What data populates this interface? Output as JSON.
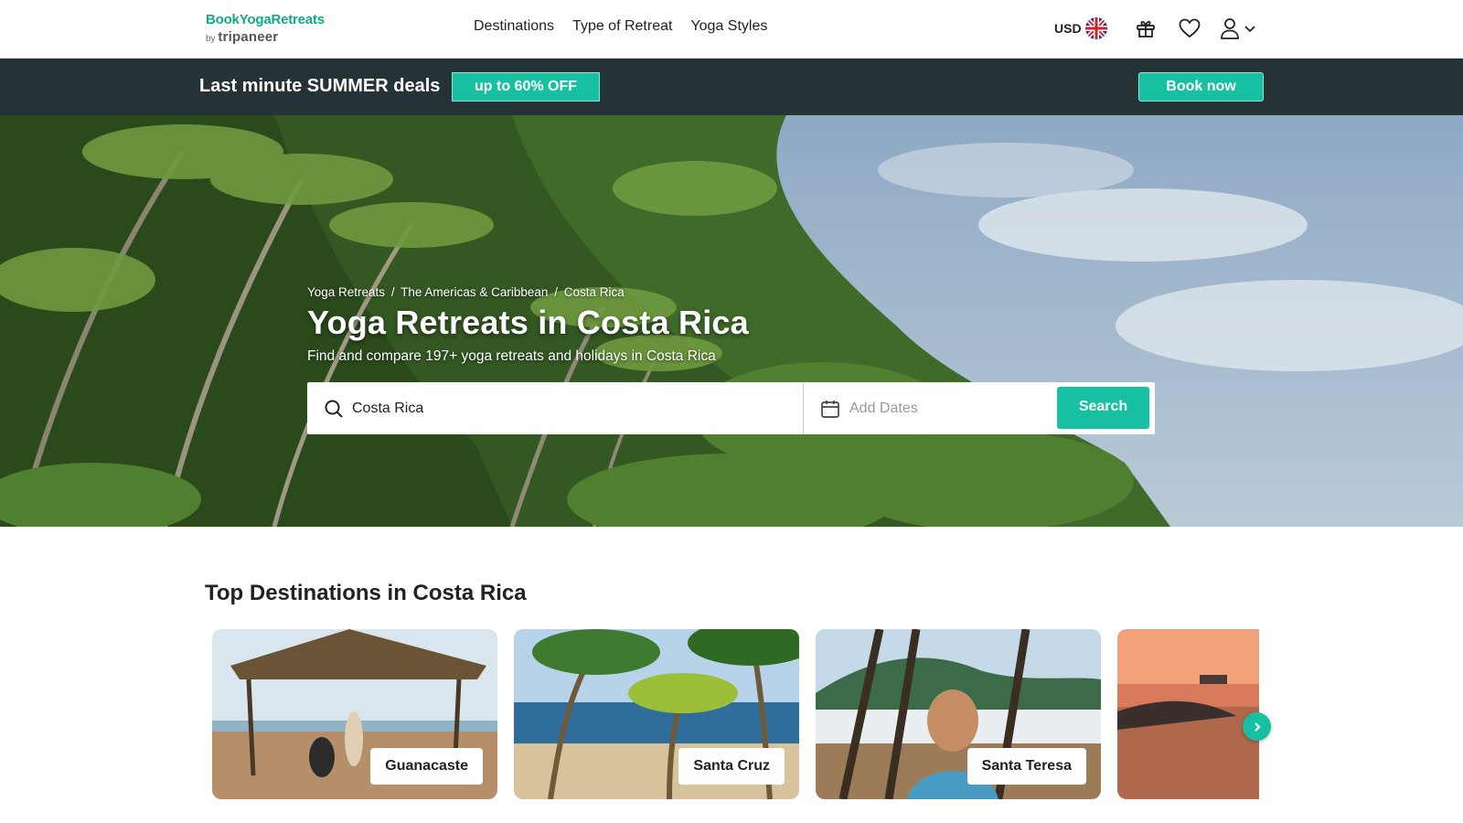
{
  "header": {
    "logo": {
      "name": "BookYogaRetreats",
      "by": "by",
      "brand": "tripaneer"
    },
    "nav": [
      {
        "label": "Destinations"
      },
      {
        "label": "Type of Retreat"
      },
      {
        "label": "Yoga Styles"
      }
    ],
    "currency": "USD",
    "icons": {
      "flag": "uk-flag-icon",
      "gift": "gift-icon",
      "wishlist": "heart-icon",
      "account": "user-icon",
      "dropdown": "chevron-down-icon"
    }
  },
  "promo": {
    "title": "Last minute SUMMER deals",
    "badge": "up to 60% OFF",
    "cta": "Book now"
  },
  "hero": {
    "breadcrumb": [
      "Yoga Retreats",
      "The Americas & Caribbean",
      "Costa Rica"
    ],
    "breadcrumb_sep": "/",
    "title": "Yoga Retreats in Costa Rica",
    "subtitle": "Find and compare 197+ yoga retreats and holidays in Costa Rica",
    "search": {
      "value": "Costa Rica",
      "date_placeholder": "Add Dates",
      "button": "Search"
    }
  },
  "destinations": {
    "title": "Top Destinations in Costa Rica",
    "cards": [
      {
        "label": "Guanacaste"
      },
      {
        "label": "Santa Cruz"
      },
      {
        "label": "Santa Teresa"
      },
      {
        "label": ""
      }
    ]
  },
  "colors": {
    "accent": "#16c0a0",
    "promo_bg": "#263336",
    "logo": "#12a88c"
  }
}
